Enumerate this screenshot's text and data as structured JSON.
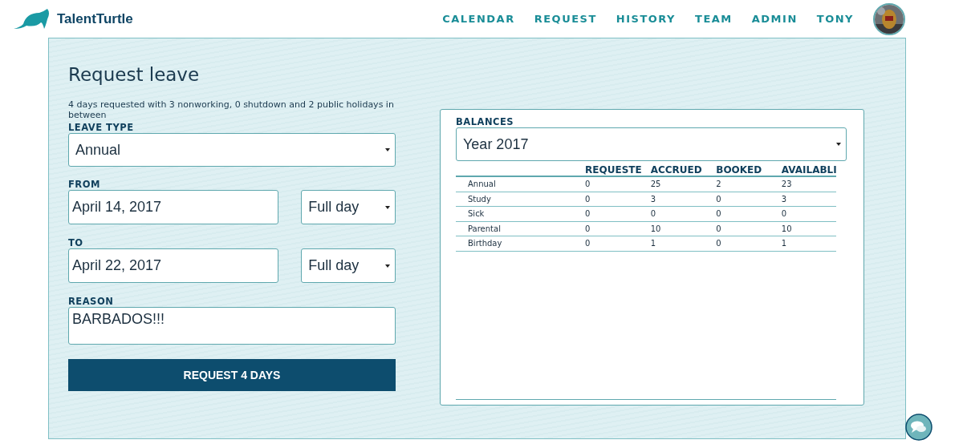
{
  "brand": "TalentTurtle",
  "nav": [
    {
      "label": "CALENDAR"
    },
    {
      "label": "REQUEST"
    },
    {
      "label": "HISTORY"
    },
    {
      "label": "TEAM"
    },
    {
      "label": "ADMIN"
    },
    {
      "label": "TONY"
    }
  ],
  "form": {
    "title": "Request leave",
    "summary": "4 days requested with 3 nonworking, 0 shutdown and 2 public holidays in between",
    "leave_type": {
      "label": "LEAVE TYPE",
      "value": "Annual"
    },
    "from": {
      "label": "FROM",
      "date": "April 14, 2017",
      "duration": "Full day"
    },
    "to": {
      "label": "TO",
      "date": "April 22, 2017",
      "duration": "Full day"
    },
    "reason": {
      "label": "REASON",
      "value": "BARBADOS!!!"
    },
    "submit": "REQUEST 4 DAYS"
  },
  "balances": {
    "label": "BALANCES",
    "year": "Year 2017",
    "columns": [
      "REQUESTE",
      "ACCRUED",
      "BOOKED",
      "AVAILABLI"
    ],
    "rows": [
      {
        "name": "Annual",
        "values": [
          "0",
          "25",
          "2",
          "23"
        ]
      },
      {
        "name": "Study",
        "values": [
          "0",
          "3",
          "0",
          "3"
        ]
      },
      {
        "name": "Sick",
        "values": [
          "0",
          "0",
          "0",
          "0"
        ]
      },
      {
        "name": "Parental",
        "values": [
          "0",
          "10",
          "0",
          "10"
        ]
      },
      {
        "name": "Birthday",
        "values": [
          "0",
          "1",
          "0",
          "1"
        ]
      }
    ]
  }
}
